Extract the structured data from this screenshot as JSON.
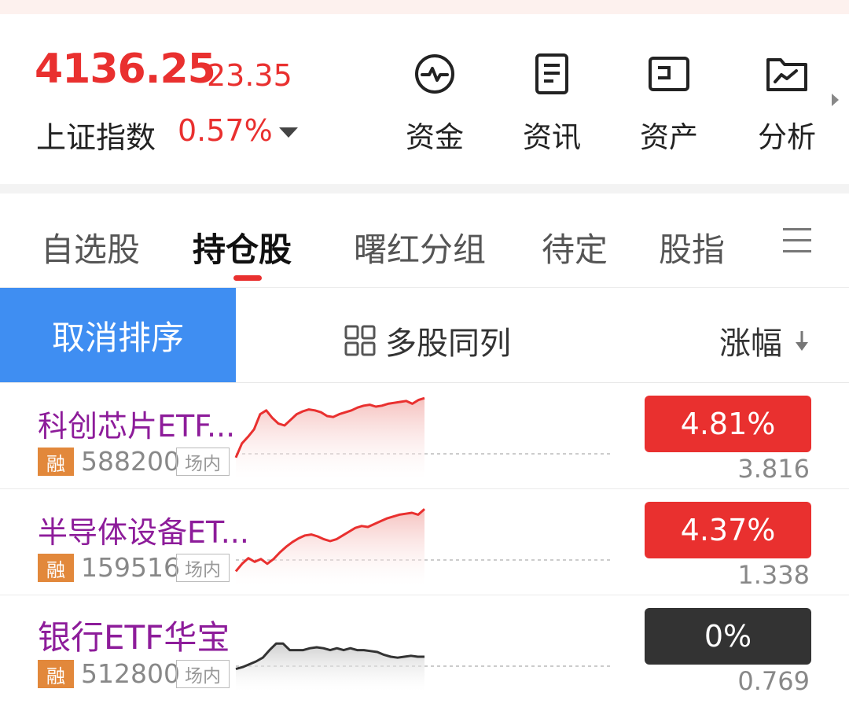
{
  "index": {
    "price": "4136.25",
    "change": "23.35",
    "name": "上证指数",
    "change_pct": "0.57%"
  },
  "quick_links": [
    {
      "label": "资金",
      "icon": "pulse-chart-icon"
    },
    {
      "label": "资讯",
      "icon": "news-document-icon"
    },
    {
      "label": "资产",
      "icon": "wallet-icon"
    },
    {
      "label": "分析",
      "icon": "analysis-folder-icon"
    }
  ],
  "tabs": [
    {
      "label": "自选股",
      "active": false
    },
    {
      "label": "持仓股",
      "active": true
    },
    {
      "label": "曙红分组",
      "active": false
    },
    {
      "label": "待定",
      "active": false
    },
    {
      "label": "股指",
      "active": false
    }
  ],
  "toolbar": {
    "cancel_sort": "取消排序",
    "multi_column": "多股同列",
    "sort_column": "涨幅"
  },
  "colors": {
    "up": "#e9302f",
    "flat": "#333333",
    "name": "#8d1c9a",
    "margin_badge": "#e2883b",
    "accent_blue": "#3f8ef2"
  },
  "stocks": [
    {
      "name": "科创芯片ETF...",
      "margin_tag": "融",
      "code": "588200",
      "market_tag": "场内",
      "change_pct": "4.81%",
      "price": "3.816",
      "trend": "up",
      "sparkline": [
        -0.4,
        1.1,
        1.8,
        2.6,
        4.2,
        4.6,
        3.8,
        3.2,
        3.0,
        3.6,
        4.2,
        4.5,
        4.7,
        4.6,
        4.4,
        4.0,
        3.9,
        4.2,
        4.4,
        4.6,
        4.9,
        5.1,
        5.2,
        5.0,
        5.1,
        5.3,
        5.4,
        5.5,
        5.6,
        5.3,
        5.7,
        5.9
      ]
    },
    {
      "name": "半导体设备ET...",
      "margin_tag": "融",
      "code": "159516",
      "market_tag": "场内",
      "change_pct": "4.37%",
      "price": "1.338",
      "trend": "up",
      "sparkline": [
        -1.2,
        -0.4,
        0.2,
        -0.2,
        0.1,
        -0.4,
        0.1,
        0.8,
        1.4,
        1.9,
        2.3,
        2.6,
        2.7,
        2.5,
        2.2,
        2.0,
        2.2,
        2.6,
        3.0,
        3.4,
        3.6,
        3.5,
        3.8,
        4.1,
        4.4,
        4.6,
        4.8,
        4.9,
        5.0,
        4.8,
        5.4
      ]
    },
    {
      "name": "银行ETF华宝",
      "margin_tag": "融",
      "code": "512800",
      "market_tag": "场内",
      "change_pct": "0%",
      "price": "0.769",
      "trend": "flat",
      "sparkline": [
        -0.3,
        -0.1,
        0.2,
        0.5,
        0.9,
        1.7,
        2.4,
        2.4,
        1.7,
        1.7,
        1.7,
        1.9,
        2.0,
        1.9,
        1.7,
        1.9,
        1.7,
        1.9,
        1.7,
        1.7,
        1.6,
        1.5,
        1.2,
        1.0,
        0.9,
        1.0,
        1.1,
        1.0,
        1.0
      ]
    }
  ]
}
